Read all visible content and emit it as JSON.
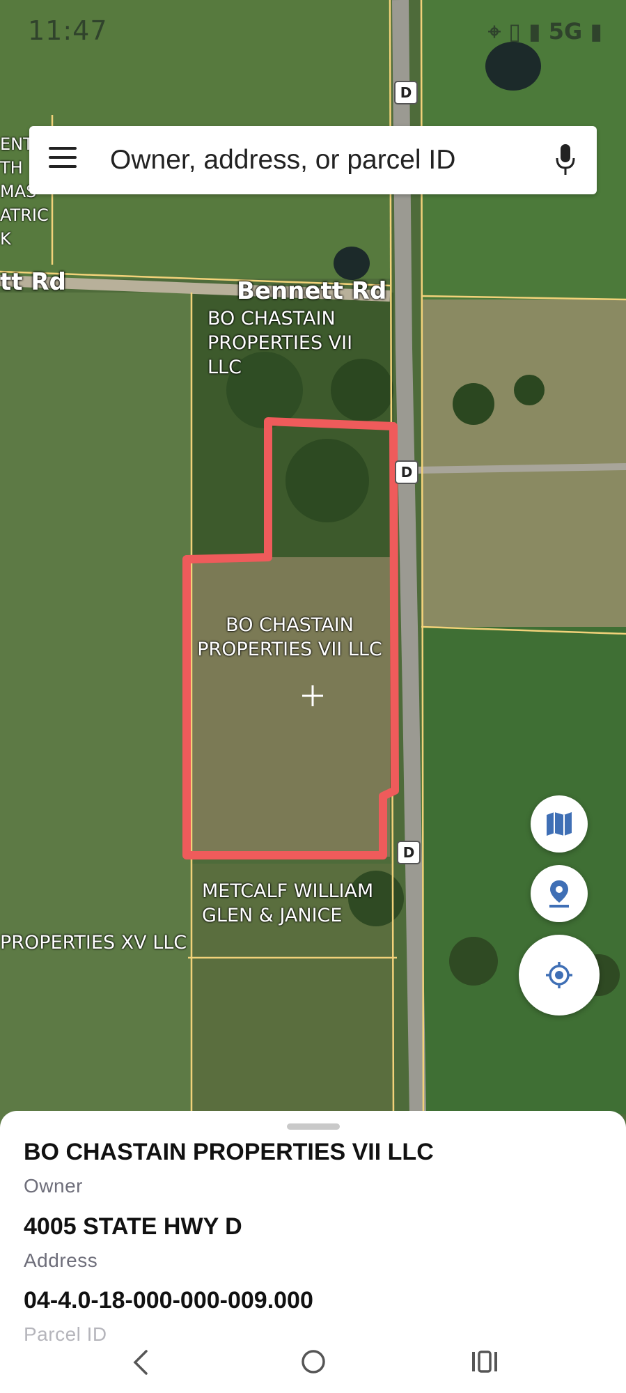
{
  "status_bar": {
    "time": "11:47",
    "network": "5G"
  },
  "search": {
    "placeholder": "Owner, address, or parcel ID"
  },
  "map": {
    "roads": [
      "Bennett Rd",
      "tt Rd"
    ],
    "highway_marker": "D",
    "parcel_labels": [
      "BO CHASTAIN PROPERTIES VII LLC",
      "BO CHASTAIN PROPERTIES VII LLC",
      "METCALF WILLIAM GLEN & JANICE",
      "PROPERTIES XV LLC"
    ],
    "parcel_labels_lines": {
      "north": [
        "BO CHASTAIN",
        "PROPERTIES VII",
        "LLC"
      ],
      "selected": [
        "BO CHASTAIN",
        "PROPERTIES VII LLC"
      ],
      "south": [
        "METCALF WILLIAM",
        "GLEN & JANICE"
      ],
      "southwest": [
        "PROPERTIES XV LLC"
      ],
      "northwest": [
        "ENT",
        "TH",
        "MAS",
        "ATRIC",
        "K"
      ]
    },
    "selection_color": "#ef5b5b",
    "parcel_line_color": "#f2d27a"
  },
  "fabs": [
    {
      "name": "map-layers-icon"
    },
    {
      "name": "location-pin-icon"
    },
    {
      "name": "my-location-icon"
    }
  ],
  "accent_color": "#3f6fb5",
  "parcel": {
    "owner": "BO CHASTAIN PROPERTIES VII LLC",
    "owner_label": "Owner",
    "address": "4005 STATE HWY D",
    "address_label": "Address",
    "parcel_id": "04-4.0-18-000-000-009.000",
    "parcel_id_label": "Parcel ID"
  }
}
